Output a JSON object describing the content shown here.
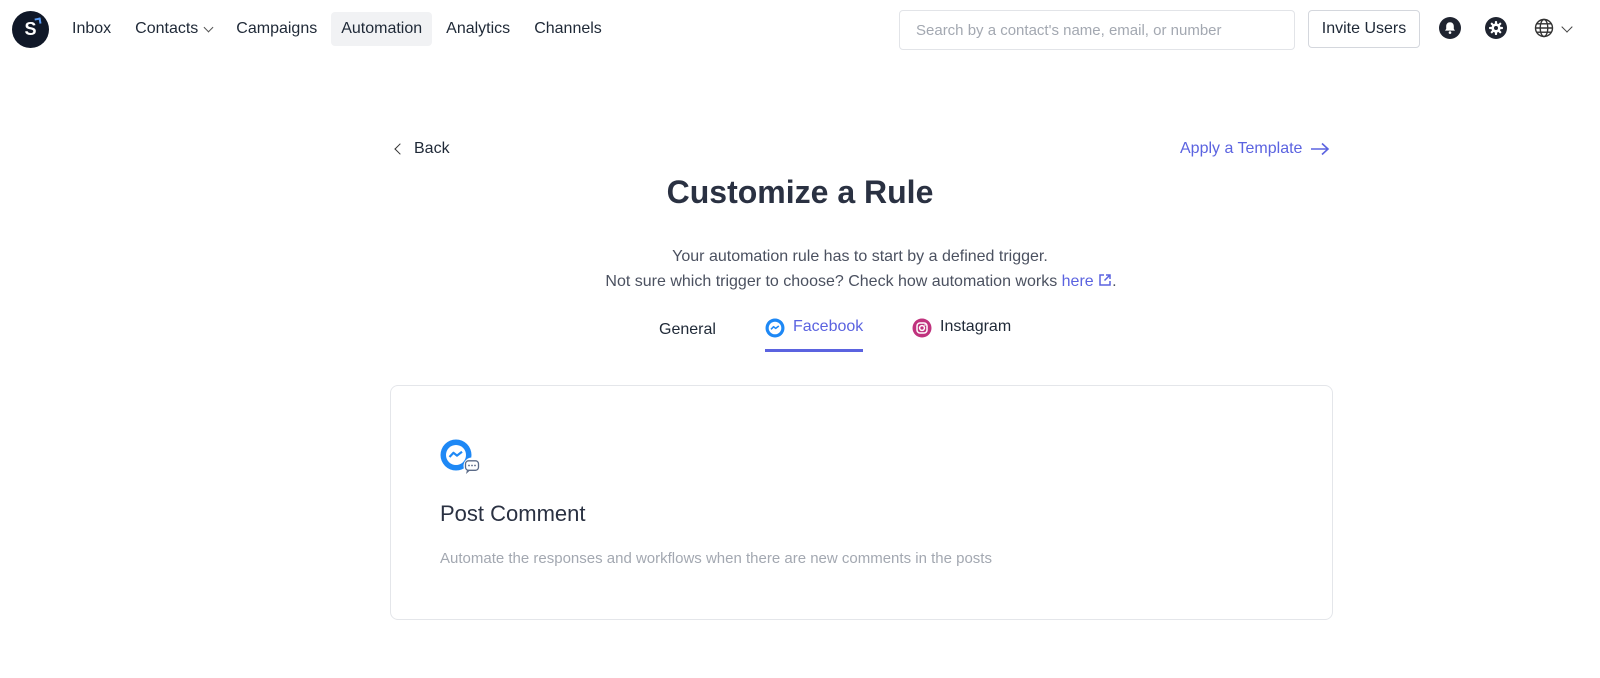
{
  "app": {
    "logo_letter": "S"
  },
  "nav": {
    "items": [
      {
        "label": "Inbox"
      },
      {
        "label": "Contacts"
      },
      {
        "label": "Campaigns"
      },
      {
        "label": "Automation"
      },
      {
        "label": "Analytics"
      },
      {
        "label": "Channels"
      }
    ],
    "active": "Automation"
  },
  "search": {
    "placeholder": "Search by a contact's name, email, or number",
    "value": ""
  },
  "header": {
    "invite_label": "Invite Users"
  },
  "icons": {
    "bell": "bell-icon",
    "settings": "gear-icon",
    "language": "globe-icon"
  },
  "page": {
    "back_label": "Back",
    "apply_template_label": "Apply a Template",
    "title": "Customize a Rule",
    "subtitle_line1": "Your automation rule has to start by a defined trigger.",
    "subtitle_line2_prefix": "Not sure which trigger to choose? Check how automation works ",
    "subtitle_link": "here",
    "subtitle_suffix": "."
  },
  "tabs": [
    {
      "label": "General"
    },
    {
      "label": "Facebook",
      "active": true
    },
    {
      "label": "Instagram"
    }
  ],
  "trigger_card": {
    "title": "Post Comment",
    "description": "Automate the responses and workflows when there are new comments in the posts"
  },
  "colors": {
    "accent": "#5b63e0",
    "logo_bg": "#101828",
    "messenger": "#1e88f5"
  }
}
